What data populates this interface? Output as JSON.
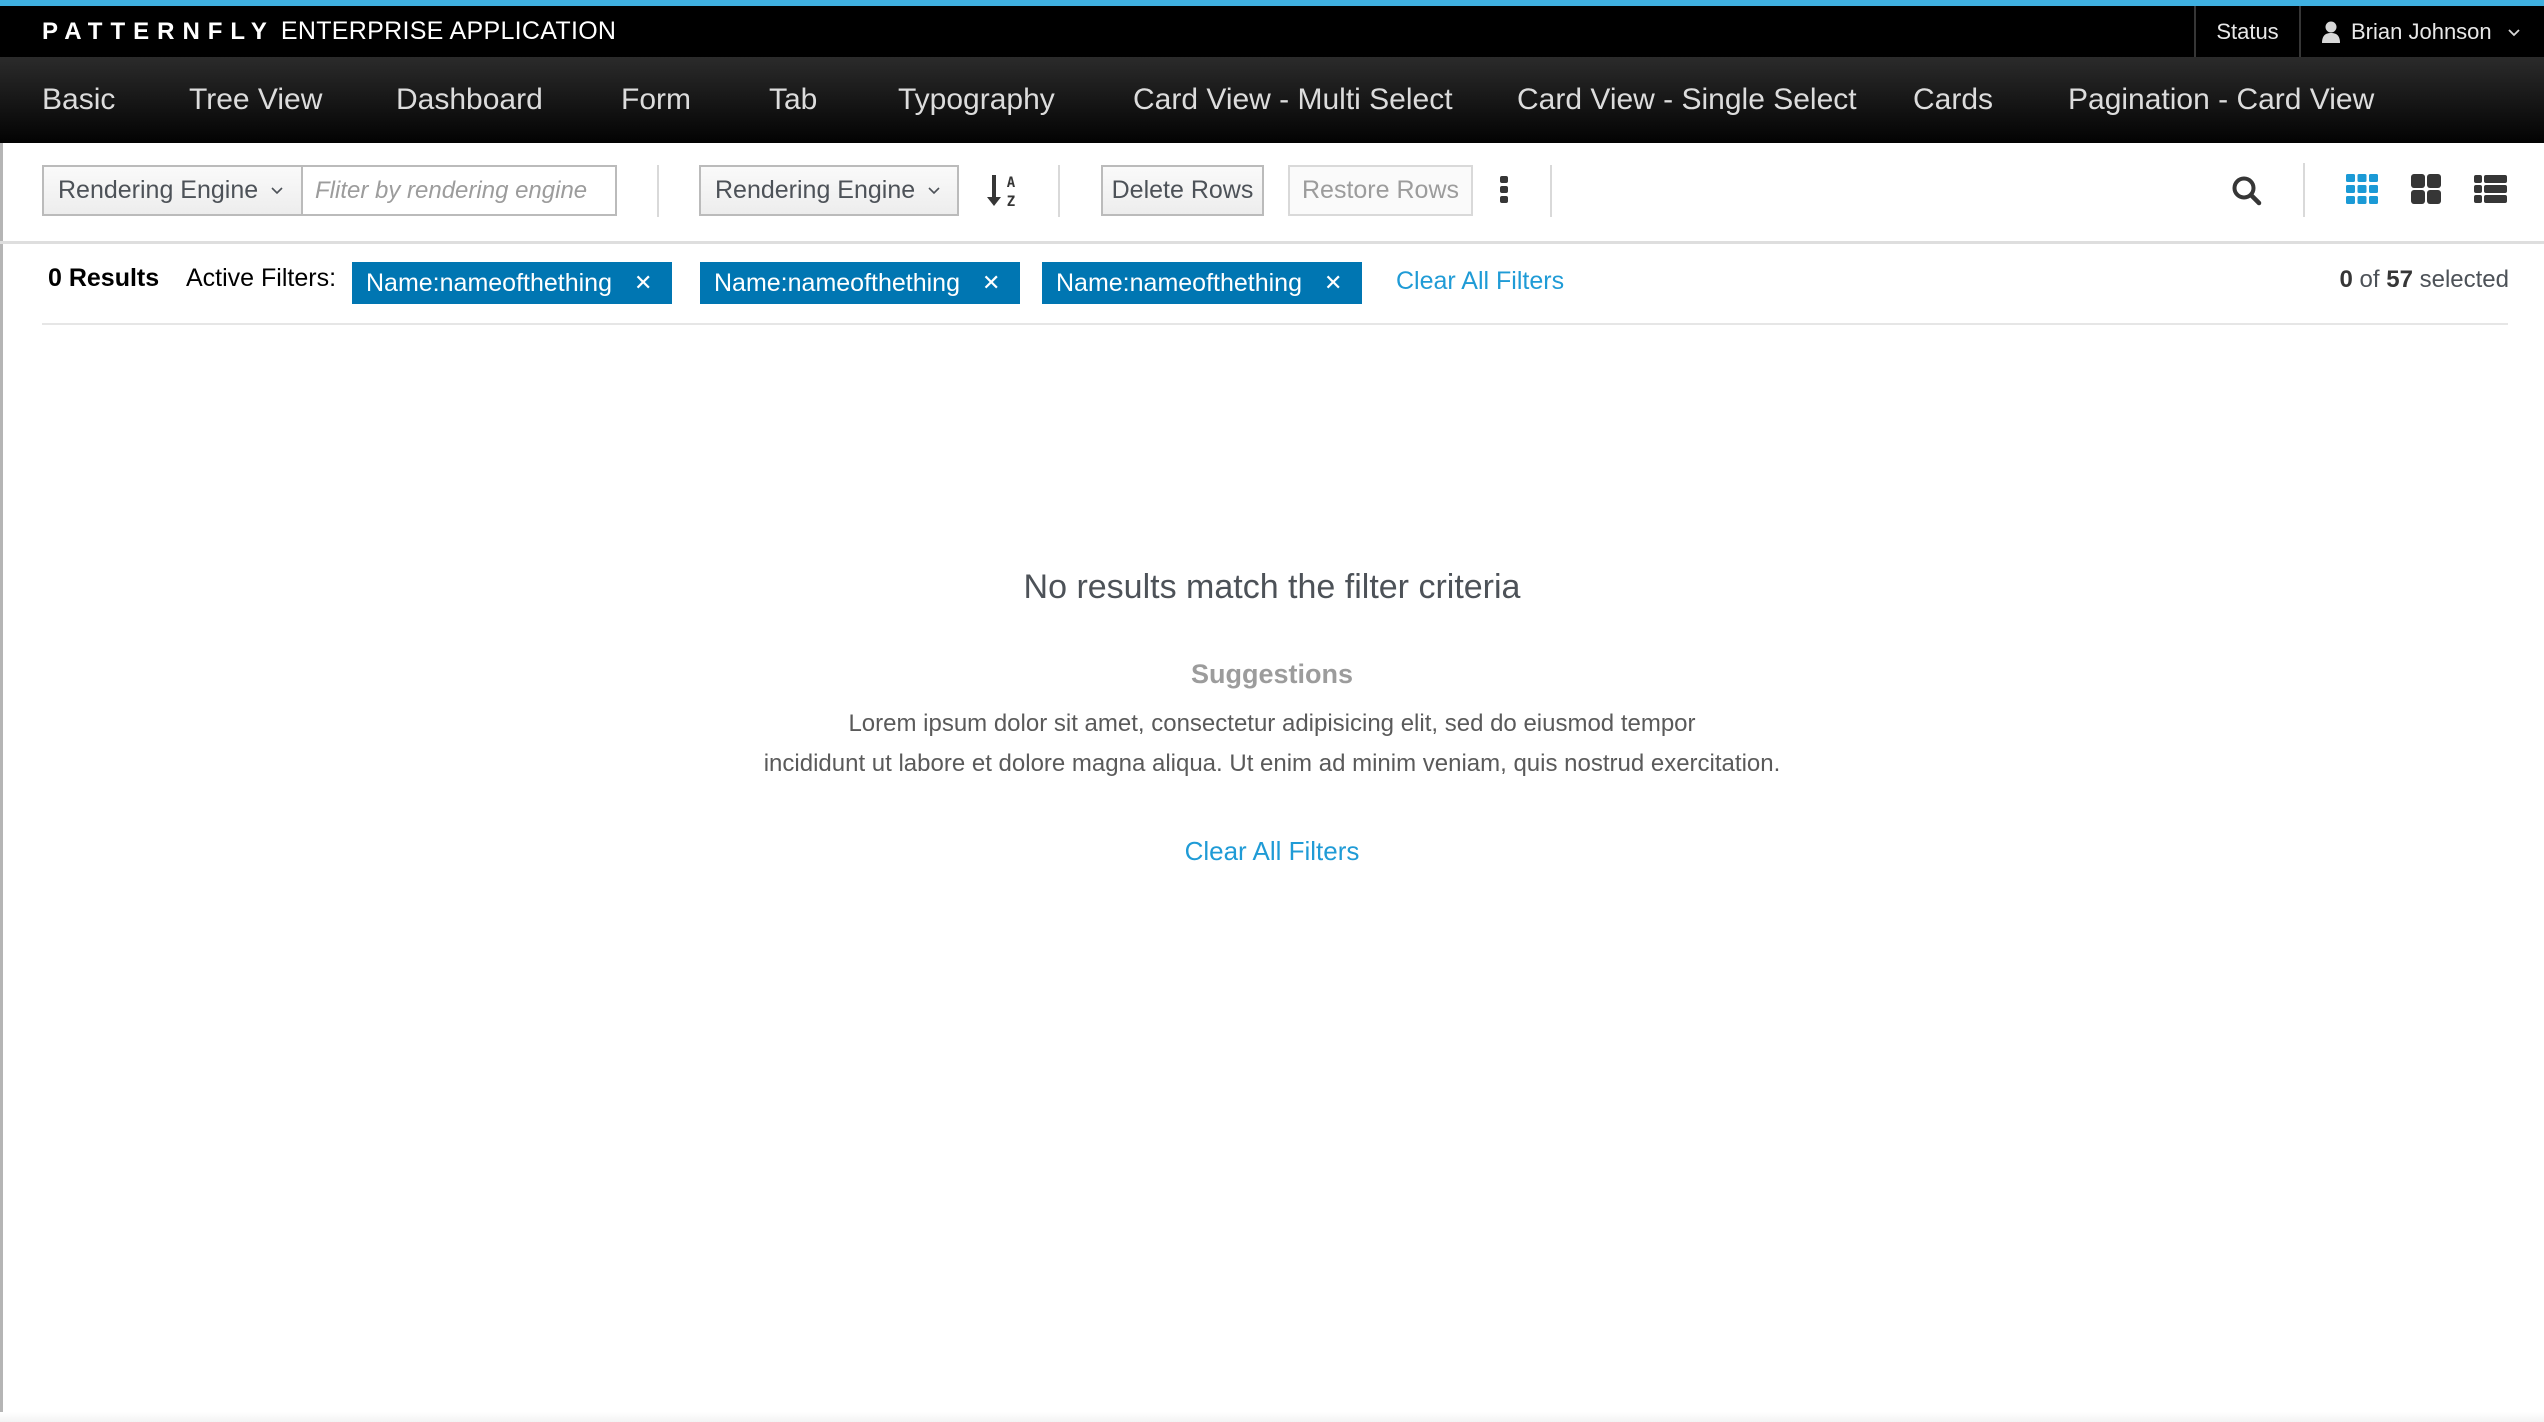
{
  "masthead": {
    "brand_logo": "PATTERNFLY",
    "brand_app": "ENTERPRISE APPLICATION",
    "status_label": "Status",
    "user_name": "Brian Johnson"
  },
  "nav": {
    "items": [
      {
        "label": "Basic"
      },
      {
        "label": "Tree View"
      },
      {
        "label": "Dashboard"
      },
      {
        "label": "Form"
      },
      {
        "label": "Tab"
      },
      {
        "label": "Typography"
      },
      {
        "label": "Card View - Multi Select"
      },
      {
        "label": "Card View - Single Select"
      },
      {
        "label": "Cards"
      },
      {
        "label": "Pagination - Card View"
      }
    ]
  },
  "toolbar": {
    "filter_field_label": "Rendering Engine",
    "filter_placeholder": "Fliter by rendering engine",
    "sort_field_label": "Rendering Engine",
    "sort_icon": "sort-alpha-asc-icon",
    "delete_label": "Delete Rows",
    "restore_label": "Restore Rows",
    "kebab_icon": "kebab-icon",
    "search_icon": "search-icon",
    "views": [
      {
        "name": "small-card-view",
        "icon": "grid-small-icon",
        "active": true
      },
      {
        "name": "large-card-view",
        "icon": "grid-large-icon",
        "active": false
      },
      {
        "name": "list-view",
        "icon": "list-icon",
        "active": false
      }
    ],
    "active_view_color": "#1b9ad6"
  },
  "results": {
    "count_label": "0 Results",
    "active_filters_label": "Active Filters:",
    "filters": [
      {
        "label": "Name:nameofthething"
      },
      {
        "label": "Name:nameofthething"
      },
      {
        "label": "Name:nameofthething"
      }
    ],
    "clear_all_label": "Clear All Filters",
    "selected": "0",
    "of_label": "of",
    "total": "57",
    "selected_label": "selected"
  },
  "empty_state": {
    "title": "No results match the filter criteria",
    "subtitle": "Suggestions",
    "text_line1": "Lorem ipsum dolor sit amet, consectetur adipisicing elit, sed do eiusmod tempor",
    "text_line2": "incididunt ut labore et dolore magna aliqua. Ut enim ad minim veniam, quis nostrud exercitation.",
    "clear_all_label": "Clear All Filters"
  },
  "colors": {
    "accent_stripe": "#3fb0e0",
    "filter_pill": "#0076b2",
    "link": "#1f9bd6"
  }
}
